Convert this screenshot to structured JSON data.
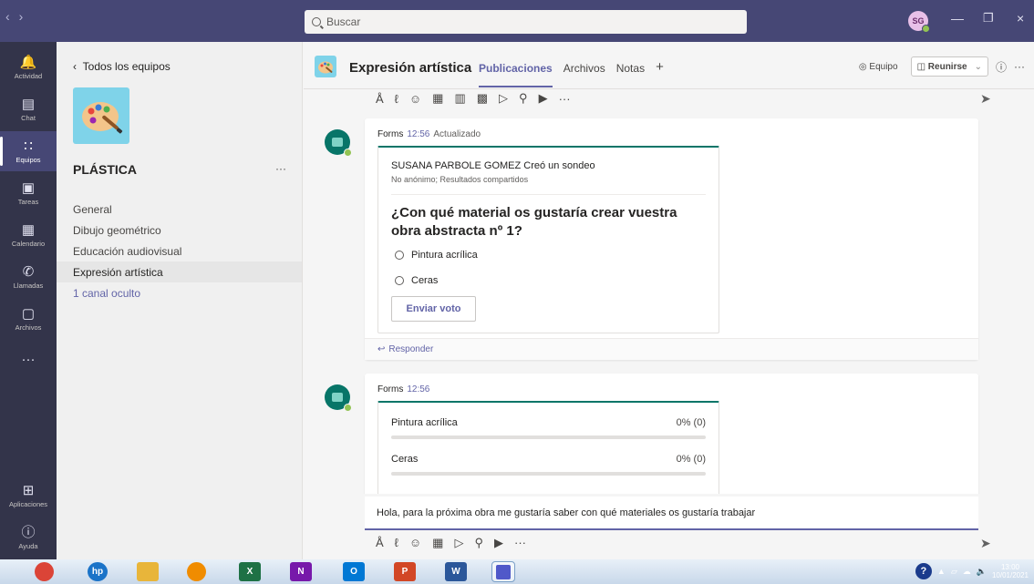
{
  "titlebar": {
    "search_placeholder": "Buscar",
    "avatar_initials": "SG"
  },
  "rail": {
    "items": [
      {
        "label": "Actividad",
        "icon": "bell-icon"
      },
      {
        "label": "Chat",
        "icon": "chat-icon"
      },
      {
        "label": "Equipos",
        "icon": "teams-icon"
      },
      {
        "label": "Tareas",
        "icon": "tasks-icon"
      },
      {
        "label": "Calendario",
        "icon": "calendar-icon"
      },
      {
        "label": "Llamadas",
        "icon": "phone-icon"
      },
      {
        "label": "Archivos",
        "icon": "files-icon"
      }
    ],
    "more": "···",
    "apps_label": "Aplicaciones",
    "help_label": "Ayuda"
  },
  "teams_panel": {
    "back_label": "Todos los equipos",
    "team_name": "PLÁSTICA",
    "more": "···",
    "channels": [
      "General",
      "Dibujo geométrico",
      "Educación audiovisual",
      "Expresión artística"
    ],
    "hidden_channels": "1 canal oculto"
  },
  "channel_header": {
    "title": "Expresión artística",
    "tabs": [
      "Publicaciones",
      "Archivos",
      "Notas"
    ],
    "add_tab": "+",
    "team_button": "Equipo",
    "meet_button": "Reunirse",
    "info": "ⓘ",
    "more": "···"
  },
  "feed": {
    "toolbar_more": "···",
    "post1": {
      "author": "Forms",
      "time": "12:56",
      "status": "Actualizado",
      "creator_line": "SUSANA PARBOLE GOMEZ Creó un sondeo",
      "subline": "No anónimo; Resultados compartidos",
      "question": "¿Con qué material os gustaría crear vuestra obra abstracta nº 1?",
      "options": [
        "Pintura acrílica",
        "Ceras"
      ],
      "vote_button": "Enviar voto",
      "reply": "Responder"
    },
    "post2": {
      "author": "Forms",
      "time": "12:56",
      "results": [
        {
          "label": "Pintura acrílica",
          "pct_text": "0% (0)",
          "fraction": 0
        },
        {
          "label": "Ceras",
          "pct_text": "0% (0)",
          "fraction": 0
        }
      ]
    }
  },
  "compose": {
    "text": "Hola, para la próxima obra me gustaría saber con qué materiales os gustaría trabajar",
    "more": "···"
  },
  "taskbar": {
    "time": "13:00",
    "date": "10/01/2021"
  },
  "colors": {
    "brand": "#6264a7",
    "titlebar": "#464775",
    "rail": "#33344a",
    "forms": "#077568"
  }
}
